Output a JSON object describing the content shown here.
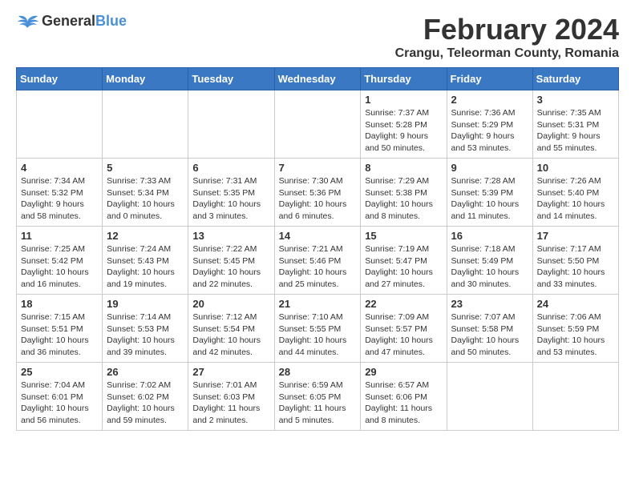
{
  "logo": {
    "general": "General",
    "blue": "Blue"
  },
  "header": {
    "month": "February 2024",
    "location": "Crangu, Teleorman County, Romania"
  },
  "weekdays": [
    "Sunday",
    "Monday",
    "Tuesday",
    "Wednesday",
    "Thursday",
    "Friday",
    "Saturday"
  ],
  "weeks": [
    [
      {
        "day": "",
        "info": ""
      },
      {
        "day": "",
        "info": ""
      },
      {
        "day": "",
        "info": ""
      },
      {
        "day": "",
        "info": ""
      },
      {
        "day": "1",
        "info": "Sunrise: 7:37 AM\nSunset: 5:28 PM\nDaylight: 9 hours and 50 minutes."
      },
      {
        "day": "2",
        "info": "Sunrise: 7:36 AM\nSunset: 5:29 PM\nDaylight: 9 hours and 53 minutes."
      },
      {
        "day": "3",
        "info": "Sunrise: 7:35 AM\nSunset: 5:31 PM\nDaylight: 9 hours and 55 minutes."
      }
    ],
    [
      {
        "day": "4",
        "info": "Sunrise: 7:34 AM\nSunset: 5:32 PM\nDaylight: 9 hours and 58 minutes."
      },
      {
        "day": "5",
        "info": "Sunrise: 7:33 AM\nSunset: 5:34 PM\nDaylight: 10 hours and 0 minutes."
      },
      {
        "day": "6",
        "info": "Sunrise: 7:31 AM\nSunset: 5:35 PM\nDaylight: 10 hours and 3 minutes."
      },
      {
        "day": "7",
        "info": "Sunrise: 7:30 AM\nSunset: 5:36 PM\nDaylight: 10 hours and 6 minutes."
      },
      {
        "day": "8",
        "info": "Sunrise: 7:29 AM\nSunset: 5:38 PM\nDaylight: 10 hours and 8 minutes."
      },
      {
        "day": "9",
        "info": "Sunrise: 7:28 AM\nSunset: 5:39 PM\nDaylight: 10 hours and 11 minutes."
      },
      {
        "day": "10",
        "info": "Sunrise: 7:26 AM\nSunset: 5:40 PM\nDaylight: 10 hours and 14 minutes."
      }
    ],
    [
      {
        "day": "11",
        "info": "Sunrise: 7:25 AM\nSunset: 5:42 PM\nDaylight: 10 hours and 16 minutes."
      },
      {
        "day": "12",
        "info": "Sunrise: 7:24 AM\nSunset: 5:43 PM\nDaylight: 10 hours and 19 minutes."
      },
      {
        "day": "13",
        "info": "Sunrise: 7:22 AM\nSunset: 5:45 PM\nDaylight: 10 hours and 22 minutes."
      },
      {
        "day": "14",
        "info": "Sunrise: 7:21 AM\nSunset: 5:46 PM\nDaylight: 10 hours and 25 minutes."
      },
      {
        "day": "15",
        "info": "Sunrise: 7:19 AM\nSunset: 5:47 PM\nDaylight: 10 hours and 27 minutes."
      },
      {
        "day": "16",
        "info": "Sunrise: 7:18 AM\nSunset: 5:49 PM\nDaylight: 10 hours and 30 minutes."
      },
      {
        "day": "17",
        "info": "Sunrise: 7:17 AM\nSunset: 5:50 PM\nDaylight: 10 hours and 33 minutes."
      }
    ],
    [
      {
        "day": "18",
        "info": "Sunrise: 7:15 AM\nSunset: 5:51 PM\nDaylight: 10 hours and 36 minutes."
      },
      {
        "day": "19",
        "info": "Sunrise: 7:14 AM\nSunset: 5:53 PM\nDaylight: 10 hours and 39 minutes."
      },
      {
        "day": "20",
        "info": "Sunrise: 7:12 AM\nSunset: 5:54 PM\nDaylight: 10 hours and 42 minutes."
      },
      {
        "day": "21",
        "info": "Sunrise: 7:10 AM\nSunset: 5:55 PM\nDaylight: 10 hours and 44 minutes."
      },
      {
        "day": "22",
        "info": "Sunrise: 7:09 AM\nSunset: 5:57 PM\nDaylight: 10 hours and 47 minutes."
      },
      {
        "day": "23",
        "info": "Sunrise: 7:07 AM\nSunset: 5:58 PM\nDaylight: 10 hours and 50 minutes."
      },
      {
        "day": "24",
        "info": "Sunrise: 7:06 AM\nSunset: 5:59 PM\nDaylight: 10 hours and 53 minutes."
      }
    ],
    [
      {
        "day": "25",
        "info": "Sunrise: 7:04 AM\nSunset: 6:01 PM\nDaylight: 10 hours and 56 minutes."
      },
      {
        "day": "26",
        "info": "Sunrise: 7:02 AM\nSunset: 6:02 PM\nDaylight: 10 hours and 59 minutes."
      },
      {
        "day": "27",
        "info": "Sunrise: 7:01 AM\nSunset: 6:03 PM\nDaylight: 11 hours and 2 minutes."
      },
      {
        "day": "28",
        "info": "Sunrise: 6:59 AM\nSunset: 6:05 PM\nDaylight: 11 hours and 5 minutes."
      },
      {
        "day": "29",
        "info": "Sunrise: 6:57 AM\nSunset: 6:06 PM\nDaylight: 11 hours and 8 minutes."
      },
      {
        "day": "",
        "info": ""
      },
      {
        "day": "",
        "info": ""
      }
    ]
  ]
}
